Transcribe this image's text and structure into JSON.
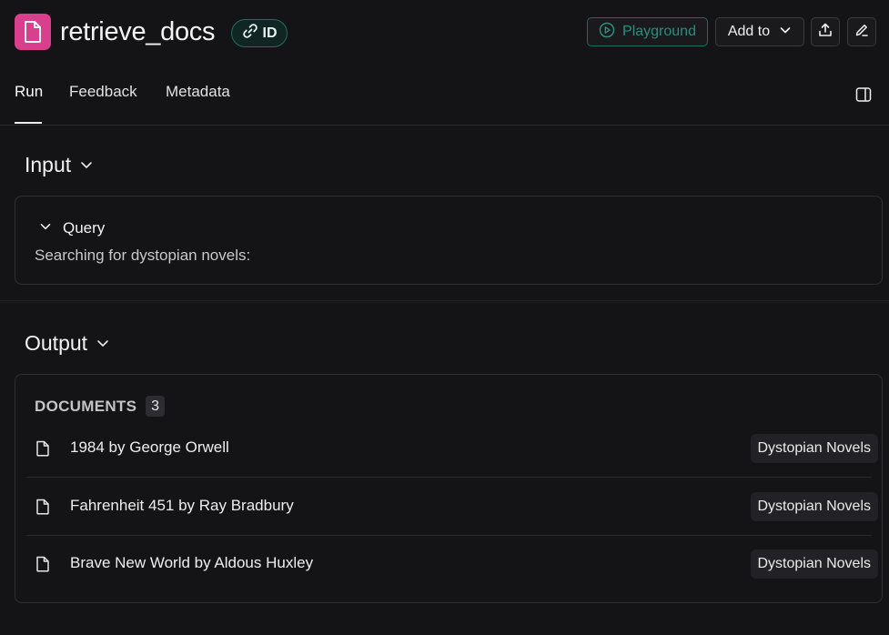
{
  "header": {
    "run_name": "retrieve_docs",
    "id_badge": "ID",
    "playground_label": "Playground",
    "add_to_label": "Add to"
  },
  "tabs": [
    {
      "label": "Run",
      "active": true
    },
    {
      "label": "Feedback",
      "active": false
    },
    {
      "label": "Metadata",
      "active": false
    }
  ],
  "input": {
    "title": "Input",
    "query_label": "Query",
    "query_value": "Searching for dystopian novels:"
  },
  "output": {
    "title": "Output",
    "documents_label": "DOCUMENTS",
    "documents_count": "3",
    "documents": [
      {
        "title": "1984 by George Orwell",
        "tag": "Dystopian Novels"
      },
      {
        "title": "Fahrenheit 451 by Ray Bradbury",
        "tag": "Dystopian Novels"
      },
      {
        "title": "Brave New World by Aldous Huxley",
        "tag": "Dystopian Novels"
      }
    ]
  },
  "colors": {
    "run_icon_bg": "#d93f8c",
    "accent_teal": "#2b8d80",
    "background": "#141416"
  }
}
